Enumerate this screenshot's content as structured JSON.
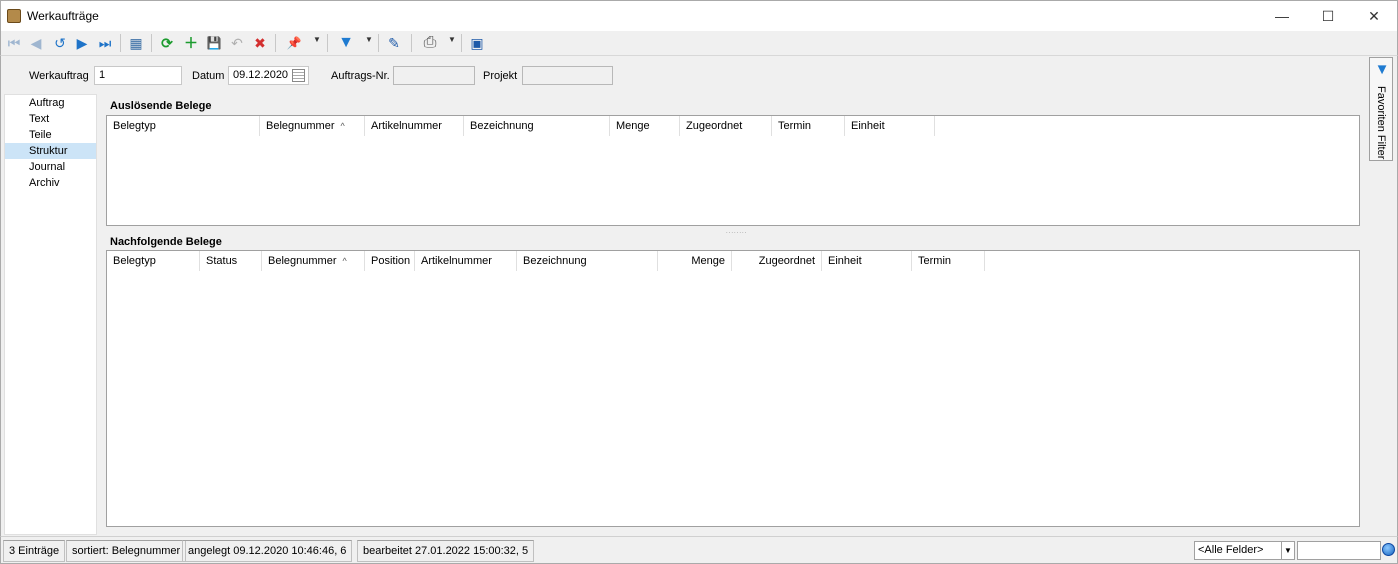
{
  "window": {
    "title": "Werkaufträge",
    "minimize": "—",
    "maximize": "☐",
    "close": "✕"
  },
  "toolbar": {
    "first": "⏮",
    "prev": "◀",
    "reset": "↺",
    "next": "▶",
    "last": "⏭",
    "grid": "▦",
    "refresh": "⟳",
    "new": "＋",
    "save": "💾",
    "undo": "↶",
    "delete": "✖",
    "pin": "📌",
    "filter": "▼",
    "edit": "✎",
    "print": "⎙",
    "info": "▣",
    "dropdown": "▼"
  },
  "header_fields": {
    "werkauftrag_label": "Werkauftrag",
    "werkauftrag_value": "1",
    "datum_label": "Datum",
    "datum_value": "09.12.2020",
    "auftragsnr_label": "Auftrags-Nr.",
    "auftragsnr_value": "",
    "projekt_label": "Projekt",
    "projekt_value": ""
  },
  "nav": {
    "items": [
      {
        "label": "Auftrag"
      },
      {
        "label": "Text"
      },
      {
        "label": "Teile"
      },
      {
        "label": "Struktur",
        "selected": true
      },
      {
        "label": "Journal"
      },
      {
        "label": "Archiv"
      }
    ]
  },
  "ausloesende": {
    "title": "Auslösende Belege",
    "columns": [
      "Belegtyp",
      "Belegnummer",
      "Artikelnummer",
      "Bezeichnung",
      "Menge",
      "Zugeordnet",
      "Termin",
      "Einheit"
    ],
    "sort_arrow": "^"
  },
  "nachfolgende": {
    "title": "Nachfolgende Belege",
    "columns": [
      "Belegtyp",
      "Status",
      "Belegnummer",
      "Position",
      "Artikelnummer",
      "Bezeichnung",
      "Menge",
      "Zugeordnet",
      "Einheit",
      "Termin"
    ],
    "sort_arrow": "^"
  },
  "splitter": "........",
  "side_tab": {
    "label": "Favoriten Filter",
    "icon": "▼"
  },
  "status": {
    "count": "3 Einträge",
    "sorted": "sortiert: Belegnummer",
    "created": "angelegt 09.12.2020 10:46:46,  6",
    "edited": "bearbeitet 27.01.2022 15:00:32,  5",
    "search_field": "<Alle Felder>",
    "select_arrow": "▼",
    "search_value": ""
  }
}
